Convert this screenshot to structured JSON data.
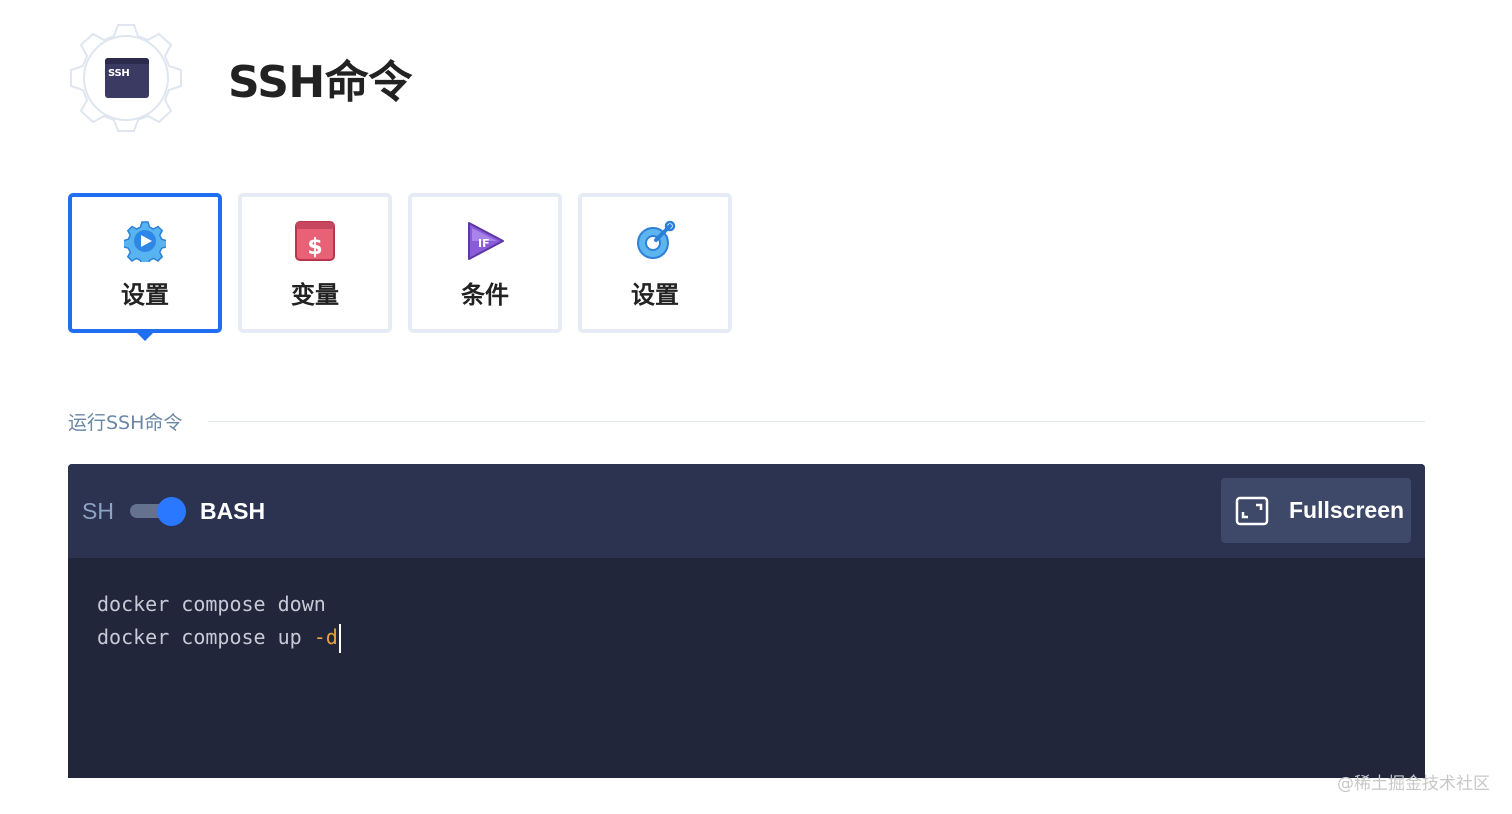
{
  "header": {
    "title": "SSH命令",
    "badge_text": "SSH",
    "badge_icon": "ssh-terminal-icon"
  },
  "tabs": [
    {
      "label": "设置",
      "icon": "play-gear-icon",
      "active": true
    },
    {
      "label": "变量",
      "icon": "dollar-icon",
      "active": false
    },
    {
      "label": "条件",
      "icon": "if-play-icon",
      "active": false
    },
    {
      "label": "设置",
      "icon": "gear-wrench-icon",
      "active": false
    }
  ],
  "section": {
    "title": "运行SSH命令"
  },
  "editor": {
    "lang_left": "SH",
    "lang_right": "BASH",
    "toggle_on": true,
    "fullscreen_label": "Fullscreen",
    "line1": "docker compose down",
    "line2_prefix": "docker compose up ",
    "line2_flag": "-d"
  },
  "colors": {
    "accent": "#1f6ff0",
    "editor_bg": "#22263a",
    "toolbar_bg": "#2c3350",
    "flag": "#e7a23f"
  },
  "watermark": "@稀土掘金技术社区"
}
